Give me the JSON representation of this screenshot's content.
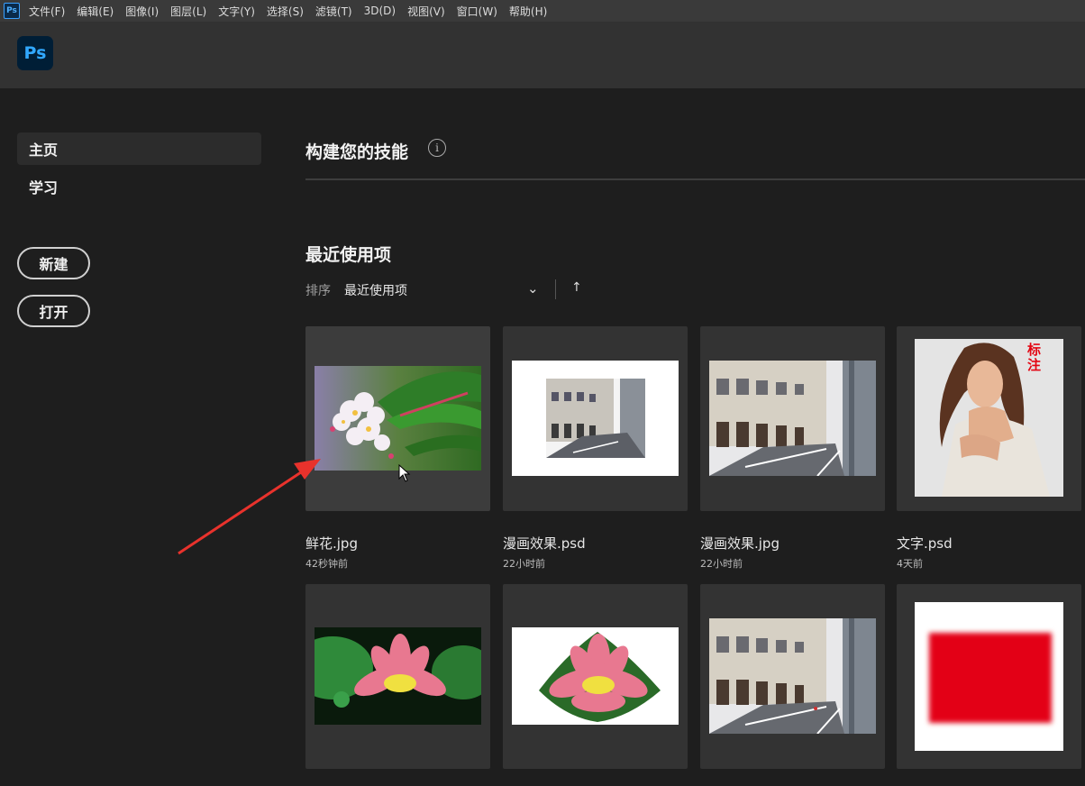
{
  "menubar": {
    "app_icon": "Ps",
    "items": [
      "文件(F)",
      "编辑(E)",
      "图像(I)",
      "图层(L)",
      "文字(Y)",
      "选择(S)",
      "滤镜(T)",
      "3D(D)",
      "视图(V)",
      "窗口(W)",
      "帮助(H)"
    ]
  },
  "header": {
    "logo": "Ps"
  },
  "sidebar": {
    "home": "主页",
    "learn": "学习",
    "new_button": "新建",
    "open_button": "打开"
  },
  "main": {
    "skills_title": "构建您的技能",
    "info_icon": "i",
    "recent_title": "最近使用项",
    "sort_label": "排序",
    "sort_value": "最近使用项",
    "sort_chevron": "⌄",
    "sort_direction": "↑"
  },
  "recent": [
    {
      "name": "鲜花.jpg",
      "time": "42秒钟前"
    },
    {
      "name": "漫画效果.psd",
      "time": "22小时前"
    },
    {
      "name": "漫画效果.jpg",
      "time": "22小时前"
    },
    {
      "name": "文字.psd",
      "time": "4天前",
      "thumb_text": "标注"
    },
    {
      "name": "",
      "time": ""
    },
    {
      "name": "",
      "time": ""
    },
    {
      "name": "",
      "time": ""
    },
    {
      "name": "",
      "time": ""
    }
  ],
  "colors": {
    "accent": "#31a8ff",
    "annotation_arrow": "#e8322c",
    "red_block": "#e30613"
  }
}
